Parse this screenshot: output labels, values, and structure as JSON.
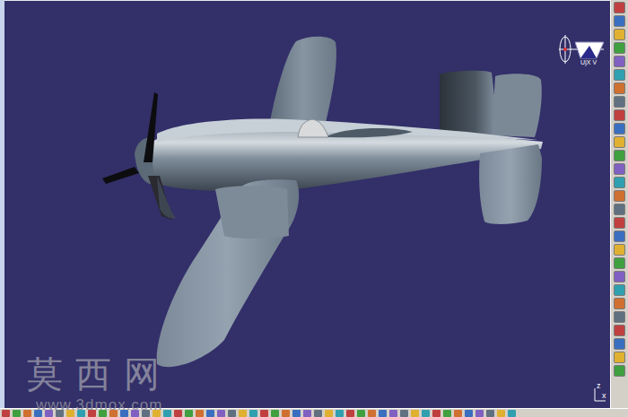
{
  "compass": {
    "label": "U|X V"
  },
  "axis": {
    "labels": [
      "z",
      "x"
    ]
  },
  "watermark": {
    "title": "莫西网",
    "url": "www.3dmox.com"
  }
}
